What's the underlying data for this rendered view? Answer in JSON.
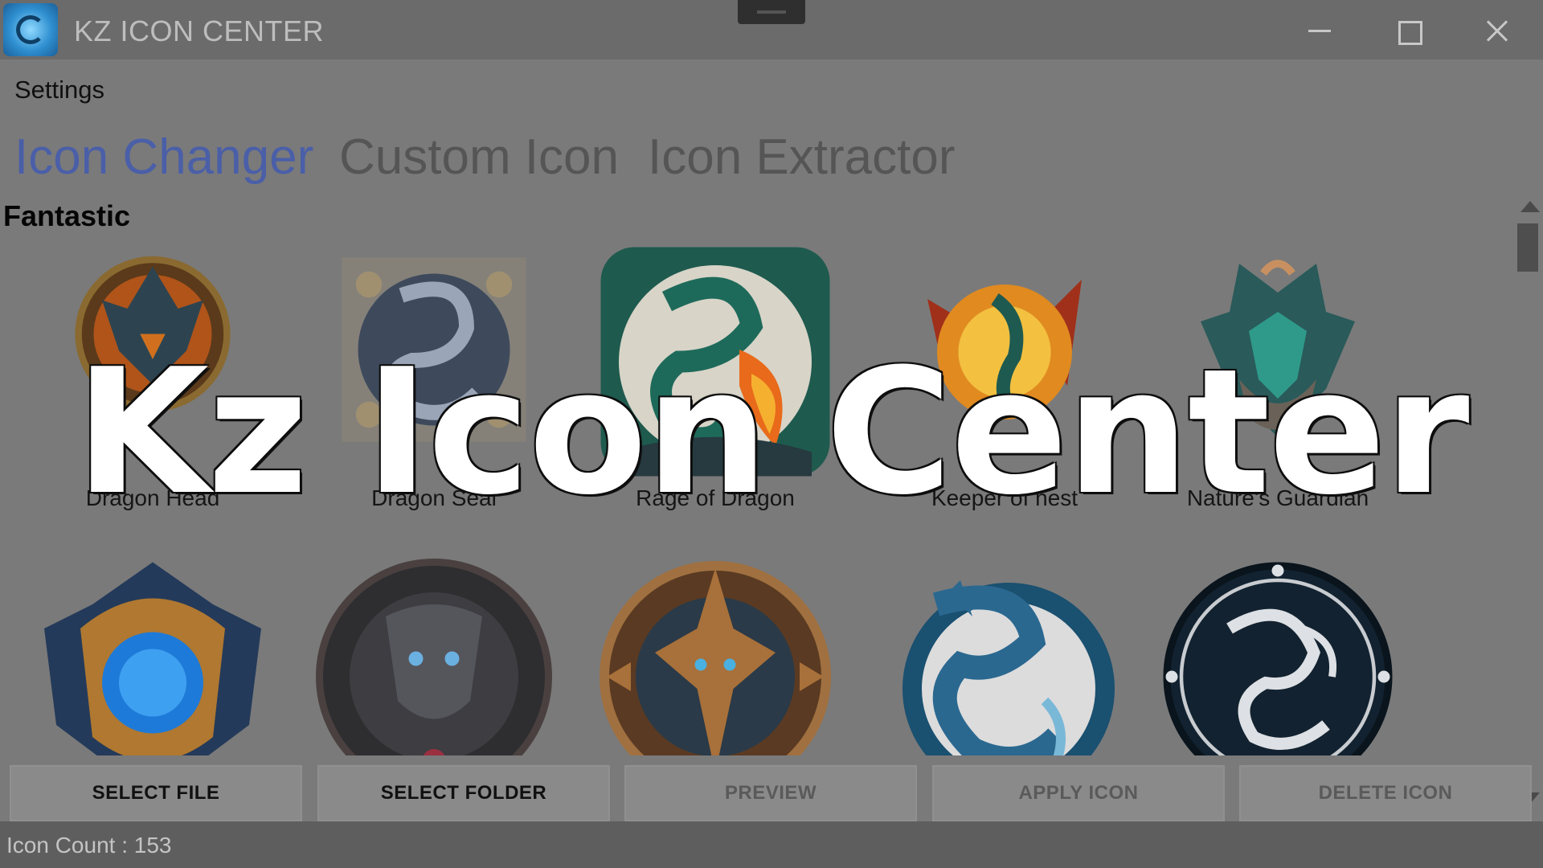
{
  "window": {
    "title": "KZ ICON CENTER"
  },
  "menu": {
    "settings": "Settings"
  },
  "tabs": [
    {
      "label": "Icon Changer",
      "active": true
    },
    {
      "label": "Custom Icon",
      "active": false
    },
    {
      "label": "Icon Extractor",
      "active": false
    }
  ],
  "group": {
    "title": "Fantastic"
  },
  "icons": {
    "row1": [
      {
        "label": "Dragon Head",
        "icon": "dragon-head-emblem-icon"
      },
      {
        "label": "Dragon Seal",
        "icon": "dragon-seal-icon"
      },
      {
        "label": "Rage of Dragon",
        "icon": "rage-of-dragon-icon"
      },
      {
        "label": "Keeper of nest",
        "icon": "keeper-of-nest-icon"
      },
      {
        "label": "Nature's Guardian",
        "icon": "natures-guardian-icon"
      }
    ],
    "row2": [
      {
        "label": "",
        "icon": "blue-orb-crest-icon"
      },
      {
        "label": "",
        "icon": "stone-beast-icon"
      },
      {
        "label": "",
        "icon": "bronze-dragon-medallion-icon"
      },
      {
        "label": "",
        "icon": "blue-dragon-circle-icon"
      },
      {
        "label": "",
        "icon": "tribal-dragon-seal-icon"
      }
    ]
  },
  "buttons": {
    "select_file": "SELECT FILE",
    "select_folder": "SELECT FOLDER",
    "preview": "PREVIEW",
    "apply_icon": "APPLY ICON",
    "delete_icon": "DELETE ICON"
  },
  "status": {
    "icon_count": "Icon Count : 153"
  },
  "overlay": {
    "title": "Kz Icon Center"
  },
  "colors": {
    "active_tab": "#4a5fa8",
    "titlebar": "#6b6b6b",
    "content_bg": "#7a7a7a"
  }
}
